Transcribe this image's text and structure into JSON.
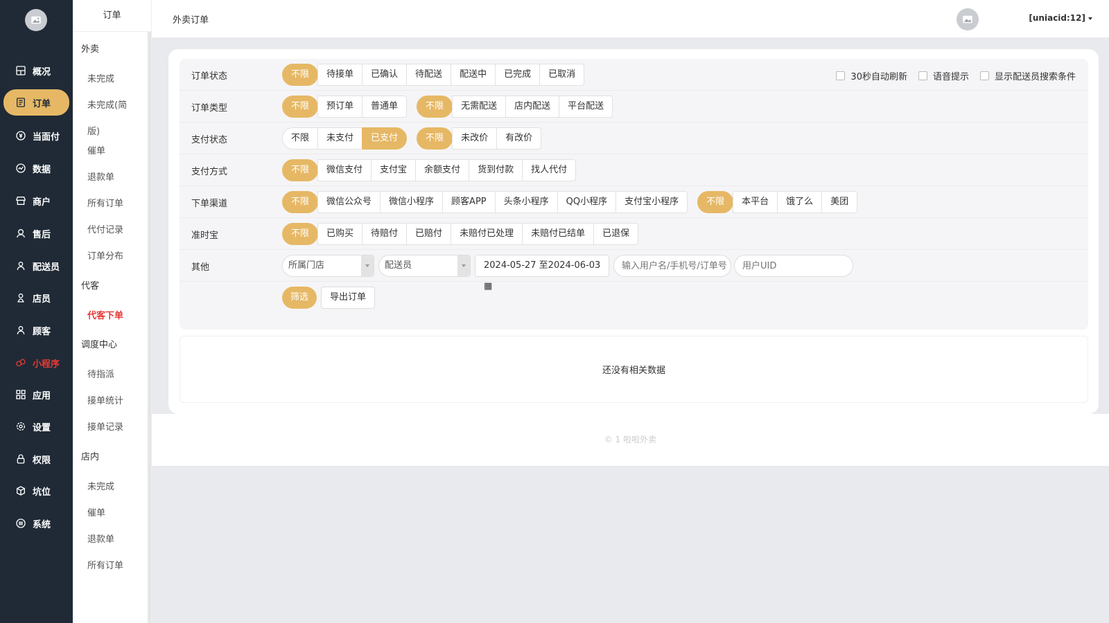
{
  "nav": {
    "items": [
      {
        "label": "概况",
        "icon": "overview-icon"
      },
      {
        "label": "订单",
        "icon": "order-icon"
      },
      {
        "label": "当面付",
        "icon": "pay-icon"
      },
      {
        "label": "数据",
        "icon": "data-icon"
      },
      {
        "label": "商户",
        "icon": "store-icon"
      },
      {
        "label": "售后",
        "icon": "aftersale-icon"
      },
      {
        "label": "配送员",
        "icon": "rider-icon"
      },
      {
        "label": "店员",
        "icon": "clerk-icon"
      },
      {
        "label": "顾客",
        "icon": "customer-icon"
      },
      {
        "label": "小程序",
        "icon": "miniapp-icon"
      },
      {
        "label": "应用",
        "icon": "apps-icon"
      },
      {
        "label": "设置",
        "icon": "settings-icon"
      },
      {
        "label": "权限",
        "icon": "lock-icon"
      },
      {
        "label": "坑位",
        "icon": "box-icon"
      },
      {
        "label": "系统",
        "icon": "system-icon"
      }
    ],
    "active": "订单",
    "highlight": "小程序"
  },
  "sub": {
    "title": "订单",
    "groups": {
      "takeout": "外卖",
      "proxy": "代客",
      "dispatch": "调度中心",
      "instore": "店内"
    },
    "links": {
      "unfinished": "未完成",
      "unfinished_simple_1": "未完成(简",
      "unfinished_simple_2": "版)",
      "urge": "催单",
      "refund": "退款单",
      "all": "所有订单",
      "proxy_pay": "代付记录",
      "distribution": "订单分布",
      "proxy_order": "代客下单",
      "pending_assign": "待指派",
      "accept_stats": "接单统计",
      "accept_records": "接单记录",
      "in_unfinished": "未完成",
      "in_urge": "催单",
      "in_refund": "退款单",
      "in_all": "所有订单"
    }
  },
  "header": {
    "breadcrumb": "外卖订单",
    "user": "[uniacid:12]"
  },
  "filters": {
    "order_status": {
      "label": "订单状态",
      "options": [
        "不限",
        "待接单",
        "已确认",
        "待配送",
        "配送中",
        "已完成",
        "已取消"
      ]
    },
    "order_type": {
      "label": "订单类型",
      "group1": [
        "不限",
        "预订单",
        "普通单"
      ],
      "group2": [
        "不限",
        "无需配送",
        "店内配送",
        "平台配送"
      ]
    },
    "pay_status": {
      "label": "支付状态",
      "group1": [
        "不限",
        "未支付",
        "已支付"
      ],
      "group2": [
        "不限",
        "未改价",
        "有改价"
      ]
    },
    "pay_method": {
      "label": "支付方式",
      "options": [
        "不限",
        "微信支付",
        "支付宝",
        "余额支付",
        "货到付款",
        "找人代付"
      ]
    },
    "channel": {
      "label": "下单渠道",
      "group1": [
        "不限",
        "微信公众号",
        "微信小程序",
        "顾客APP",
        "头条小程序",
        "QQ小程序",
        "支付宝小程序"
      ],
      "group2": [
        "不限",
        "本平台",
        "饿了么",
        "美团"
      ]
    },
    "ontime": {
      "label": "准时宝",
      "options": [
        "不限",
        "已购买",
        "待赔付",
        "已赔付",
        "未赔付已处理",
        "未赔付已结单",
        "已退保"
      ]
    },
    "other": {
      "label": "其他",
      "store_select": "所属门店",
      "rider_select": "配送员",
      "date_range": "2024-05-27 至2024-06-03",
      "keyword_placeholder": "输入用户名/手机号/订单号",
      "uid_placeholder": "用户UID"
    },
    "checks": [
      "30秒自动刷新",
      "语音提示",
      "显示配送员搜索条件"
    ],
    "filter_btn": "筛选",
    "export_btn": "导出订单"
  },
  "empty_text": "还没有相关数据",
  "footer_text": "© 1 啦啦外卖",
  "colors": {
    "accent": "#e6b865",
    "nav_bg": "#1f2a36",
    "danger": "#e33a35"
  }
}
